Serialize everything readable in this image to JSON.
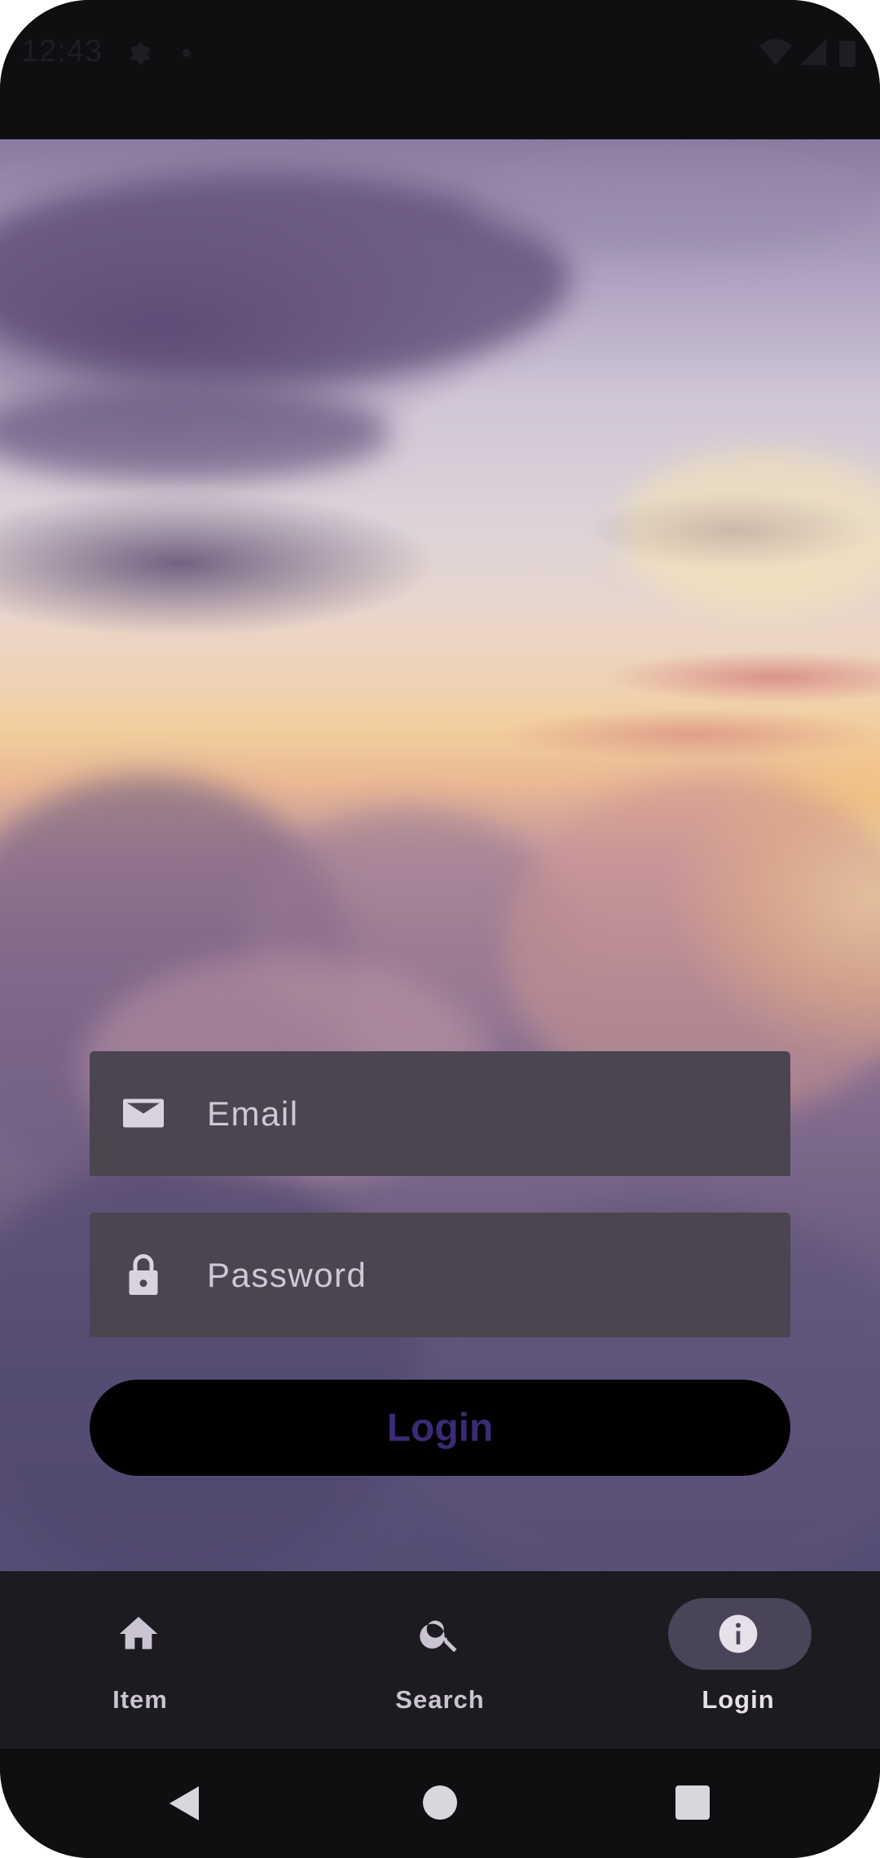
{
  "status_bar": {
    "time": "12:43"
  },
  "form": {
    "email": {
      "placeholder": "Email",
      "value": "",
      "icon": "email-icon"
    },
    "password": {
      "placeholder": "Password",
      "value": "",
      "icon": "lock-icon"
    },
    "login_button_label": "Login"
  },
  "bottom_nav": {
    "items": [
      {
        "label": "Item",
        "icon": "home-icon",
        "active": false
      },
      {
        "label": "Search",
        "icon": "search-icon",
        "active": false
      },
      {
        "label": "Login",
        "icon": "info-icon",
        "active": true
      }
    ]
  },
  "system_nav": {
    "buttons": [
      "back-icon",
      "home-circle-icon",
      "recents-icon"
    ]
  },
  "colors": {
    "field_background": "#4a4551",
    "login_text": "#3b2a74",
    "nav_background": "#1c1b20",
    "active_pill": "#4a4458"
  }
}
